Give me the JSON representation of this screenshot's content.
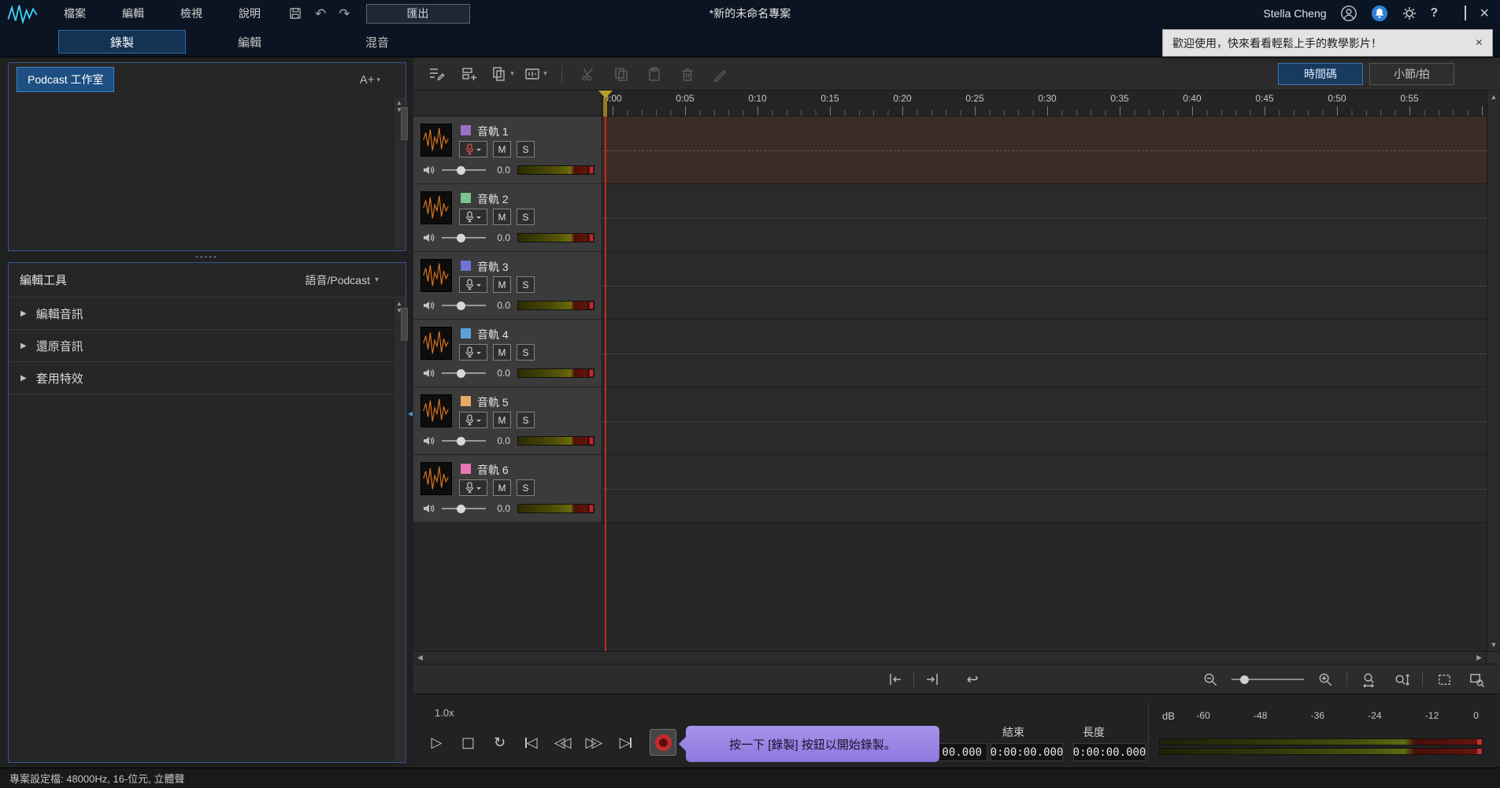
{
  "window": {
    "title": "*新的未命名專案",
    "user_name": "Stella Cheng",
    "menus": [
      "檔案",
      "編輯",
      "檢視",
      "說明"
    ],
    "export_label": "匯出",
    "status_bar": "專案設定檔: 48000Hz, 16-位元, 立體聲"
  },
  "icons": {
    "undo": "↶",
    "redo": "↷",
    "help": "?",
    "close": "×",
    "dropdown": "▾",
    "section_arrow": "▶",
    "scroll_up": "▲",
    "scroll_down": "▼",
    "scroll_left": "◀",
    "scroll_right": "▶",
    "collapse": "◂",
    "dots": "•••••",
    "play": "▷",
    "stop": "□",
    "loop": "↻",
    "tri_left": "◁",
    "tri_right": "▷",
    "undo_zoom": "↩",
    "toast_close": "×"
  },
  "toast": {
    "text": "歡迎使用，快來看看輕鬆上手的教學影片！"
  },
  "tabs": [
    "錄製",
    "編輯",
    "混音"
  ],
  "left_panel": {
    "workspace_button": "Podcast 工作室",
    "font_control": "A+",
    "tools_title": "編輯工具",
    "tools_mode": "語音/Podcast",
    "sections": [
      "編輯音訊",
      "還原音訊",
      "套用特效"
    ]
  },
  "timeline": {
    "view_timecode": "時間碼",
    "view_bars": "小節/拍",
    "ruler": [
      "0:00",
      "0:05",
      "0:10",
      "0:15",
      "0:20",
      "0:25",
      "0:30",
      "0:35",
      "0:40",
      "0:45",
      "0:50",
      "0:55"
    ],
    "mute": "M",
    "solo": "S",
    "tracks": [
      {
        "name": "音軌 1",
        "color": "#9d6fc4",
        "volume": "0.0",
        "armed": true
      },
      {
        "name": "音軌 2",
        "color": "#7cc28c",
        "volume": "0.0",
        "armed": false
      },
      {
        "name": "音軌 3",
        "color": "#6f74d6",
        "volume": "0.0",
        "armed": false
      },
      {
        "name": "音軌 4",
        "color": "#5ba2da",
        "volume": "0.0",
        "armed": false
      },
      {
        "name": "音軌 5",
        "color": "#e8aa66",
        "volume": "0.0",
        "armed": false
      },
      {
        "name": "音軌 6",
        "color": "#ea74b4",
        "volume": "0.0",
        "armed": false
      }
    ]
  },
  "transport": {
    "speed": "1.0x",
    "tooltip": "按一下 [錄製] 按鈕以開始錄製。",
    "start_partial": "00.000",
    "end_label": "結束",
    "end_value": "0:00:00.000",
    "length_label": "長度",
    "length_value": "0:00:00.000",
    "meter_unit": "dB",
    "meter_ticks": [
      "-60",
      "-48",
      "-36",
      "-24",
      "-12",
      "0"
    ]
  }
}
